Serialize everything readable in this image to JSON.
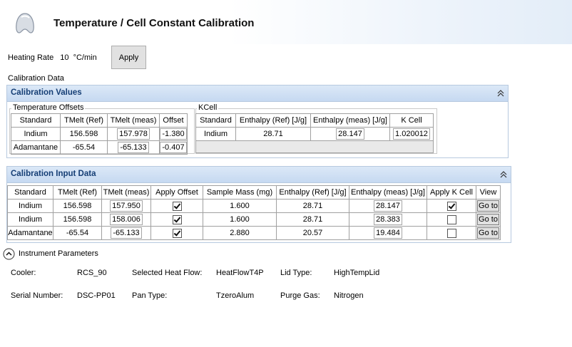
{
  "header": {
    "title": "Temperature / Cell Constant Calibration"
  },
  "heating_rate": {
    "label": "Heating Rate",
    "value": "10",
    "unit": "°C/min",
    "apply_label": "Apply"
  },
  "calibration_data_label": "Calibration Data",
  "calibration_values": {
    "title": "Calibration Values",
    "temperature_offsets": {
      "label": "Temperature Offsets",
      "headers": [
        "Standard",
        "TMelt (Ref)",
        "TMelt (meas)",
        "Offset"
      ],
      "rows": [
        [
          "Indium",
          "156.598",
          "157.978",
          "-1.380"
        ],
        [
          "Adamantane",
          "-65.54",
          "-65.133",
          "-0.407"
        ]
      ]
    },
    "kcell": {
      "label": "KCell",
      "headers": [
        "Standard",
        "Enthalpy (Ref) [J/g]",
        "Enthalpy (meas) [J/g]",
        "K Cell"
      ],
      "rows": [
        [
          "Indium",
          "28.71",
          "28.147",
          "1.020012"
        ]
      ]
    }
  },
  "calibration_input": {
    "title": "Calibration Input Data",
    "headers": [
      "Standard",
      "TMelt (Ref)",
      "TMelt (meas)",
      "Apply Offset",
      "Sample Mass (mg)",
      "Enthalpy (Ref) [J/g]",
      "Enthalpy (meas) [J/g]",
      "Apply K Cell",
      "View"
    ],
    "rows": [
      {
        "standard": "Indium",
        "tmelt_ref": "156.598",
        "tmelt_meas": "157.950",
        "apply_offset": true,
        "mass": "1.600",
        "enth_ref": "28.71",
        "enth_meas": "28.147",
        "apply_kcell": true,
        "view": "Go to"
      },
      {
        "standard": "Indium",
        "tmelt_ref": "156.598",
        "tmelt_meas": "158.006",
        "apply_offset": true,
        "mass": "1.600",
        "enth_ref": "28.71",
        "enth_meas": "28.383",
        "apply_kcell": false,
        "view": "Go to"
      },
      {
        "standard": "Adamantane",
        "tmelt_ref": "-65.54",
        "tmelt_meas": "-65.133",
        "apply_offset": true,
        "mass": "2.880",
        "enth_ref": "20.57",
        "enth_meas": "19.484",
        "apply_kcell": false,
        "view": "Go to"
      }
    ]
  },
  "instrument": {
    "title": "Instrument Parameters",
    "cooler_label": "Cooler:",
    "cooler_value": "RCS_90",
    "heatflow_label": "Selected Heat Flow:",
    "heatflow_value": "HeatFlowT4P",
    "lid_label": "Lid Type:",
    "lid_value": "HighTempLid",
    "serial_label": "Serial Number:",
    "serial_value": "DSC-PP01",
    "pan_label": "Pan Type:",
    "pan_value": "TzeroAlum",
    "purge_label": "Purge Gas:",
    "purge_value": "Nitrogen"
  }
}
